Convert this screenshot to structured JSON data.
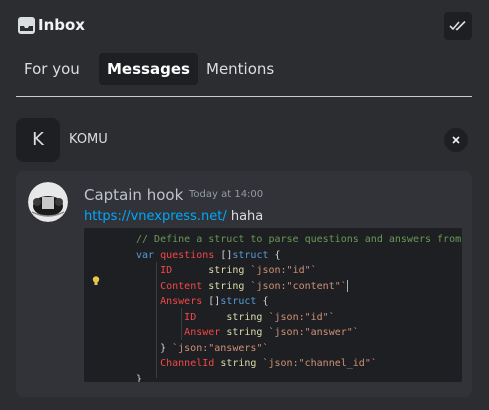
{
  "header": {
    "title": "Inbox",
    "icons": {
      "inbox": "inbox-tray-icon",
      "mark_read": "double-check-icon"
    }
  },
  "tabs": [
    {
      "label": "For you",
      "active": false
    },
    {
      "label": "Messages",
      "active": true
    },
    {
      "label": "Mentions",
      "active": false
    }
  ],
  "channel": {
    "avatar_letter": "K",
    "name": "KOMU",
    "close_icon": "close-icon"
  },
  "message": {
    "author": "Captain hook",
    "timestamp": "Today at 14:00",
    "link": "https://vnexpress.net/",
    "text": "haha"
  },
  "code": [
    [
      [
        "cm",
        "// Define a struct to parse questions and answers from t"
      ]
    ],
    [
      [
        "kw",
        "var "
      ],
      [
        "id",
        "questions "
      ],
      [
        "pn",
        "[]"
      ],
      [
        "kw",
        "struct "
      ],
      [
        "pn",
        "{"
      ]
    ],
    [
      [
        "pn",
        "    "
      ],
      [
        "id",
        "ID      "
      ],
      [
        "ty",
        "string "
      ],
      [
        "st",
        "`json:\"id\"`"
      ]
    ],
    [
      [
        "pn",
        "    "
      ],
      [
        "id",
        "Content "
      ],
      [
        "ty",
        "string "
      ],
      [
        "st",
        "`json:\"content\"`"
      ],
      [
        "cursor",
        ""
      ]
    ],
    [
      [
        "pn",
        "    "
      ],
      [
        "id",
        "Answers "
      ],
      [
        "pn",
        "[]"
      ],
      [
        "kw",
        "struct "
      ],
      [
        "pn",
        "{"
      ]
    ],
    [
      [
        "pn",
        "        "
      ],
      [
        "id",
        "ID     "
      ],
      [
        "ty",
        "string "
      ],
      [
        "st",
        "`json:\"id\"`"
      ]
    ],
    [
      [
        "pn",
        "        "
      ],
      [
        "id",
        "Answer "
      ],
      [
        "ty",
        "string "
      ],
      [
        "st",
        "`json:\"answer\"`"
      ]
    ],
    [
      [
        "pn",
        "    } "
      ],
      [
        "st",
        "`json:\"answers\"`"
      ]
    ],
    [
      [
        "pn",
        "    "
      ],
      [
        "id",
        "ChannelId "
      ],
      [
        "ty",
        "string "
      ],
      [
        "st",
        "`json:\"channel_id\"`"
      ]
    ],
    [
      [
        "pn",
        "}"
      ]
    ]
  ],
  "colors": {
    "background": "#2b2d31",
    "card": "#313338",
    "code_bg": "#1e1f22",
    "link": "#00a8fc",
    "active_tab_bg": "#1e1f22"
  }
}
